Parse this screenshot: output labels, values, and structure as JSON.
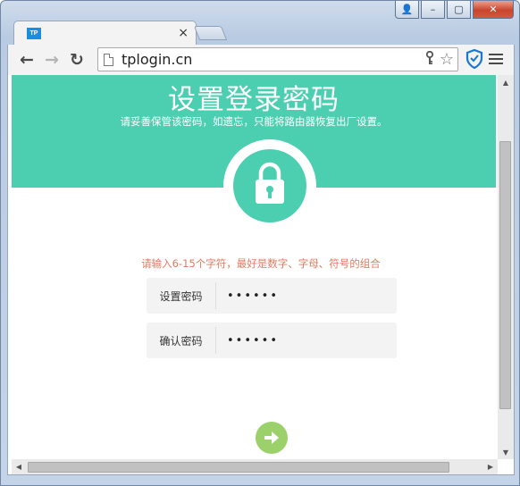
{
  "browser": {
    "tab": {
      "favicon_text": "TP",
      "title": "",
      "close_symbol": "×"
    },
    "url": "tplogin.cn",
    "window_controls": {
      "user": "👤",
      "minimize": "–",
      "maximize": "▢",
      "close": "✕"
    },
    "nav": {
      "back": "←",
      "forward": "→",
      "reload": "↻"
    },
    "icons": [
      "key-icon",
      "star-icon",
      "shield-extension-icon",
      "menu-icon"
    ]
  },
  "page": {
    "title": "设置登录密码",
    "subtitle": "请妥善保管该密码，如遗忘，只能将路由器恢复出厂设置。",
    "hint": "请输入6-15个字符，最好是数字、字母、符号的组合",
    "fields": [
      {
        "label": "设置密码",
        "value": "••••••"
      },
      {
        "label": "确认密码",
        "value": "••••••"
      }
    ],
    "colors": {
      "accent": "#4ccfb0",
      "hint": "#e07a5f",
      "next_button": "#9bd06a"
    }
  }
}
